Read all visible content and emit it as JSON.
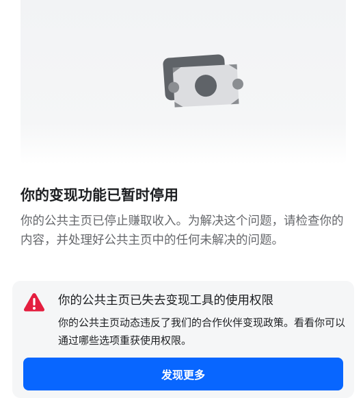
{
  "hero": {
    "icon": "money-bills-icon"
  },
  "main": {
    "title": "你的变现功能已暂时停用",
    "description": "你的公共主页已停止赚取收入。为解决这个问题，请检查你的内容，并处理好公共主页中的任何未解决的问题。"
  },
  "notice": {
    "icon": "warning-icon",
    "title": "你的公共主页已失去变现工具的使用权限",
    "body": "你的公共主页动态违反了我们的合作伙伴变现政策。看看你可以通过哪些选项重获使用权限。",
    "button_label": "发现更多"
  },
  "colors": {
    "accent": "#0866ff",
    "warning": "#e41e3f",
    "secondary_text": "#65676b"
  }
}
